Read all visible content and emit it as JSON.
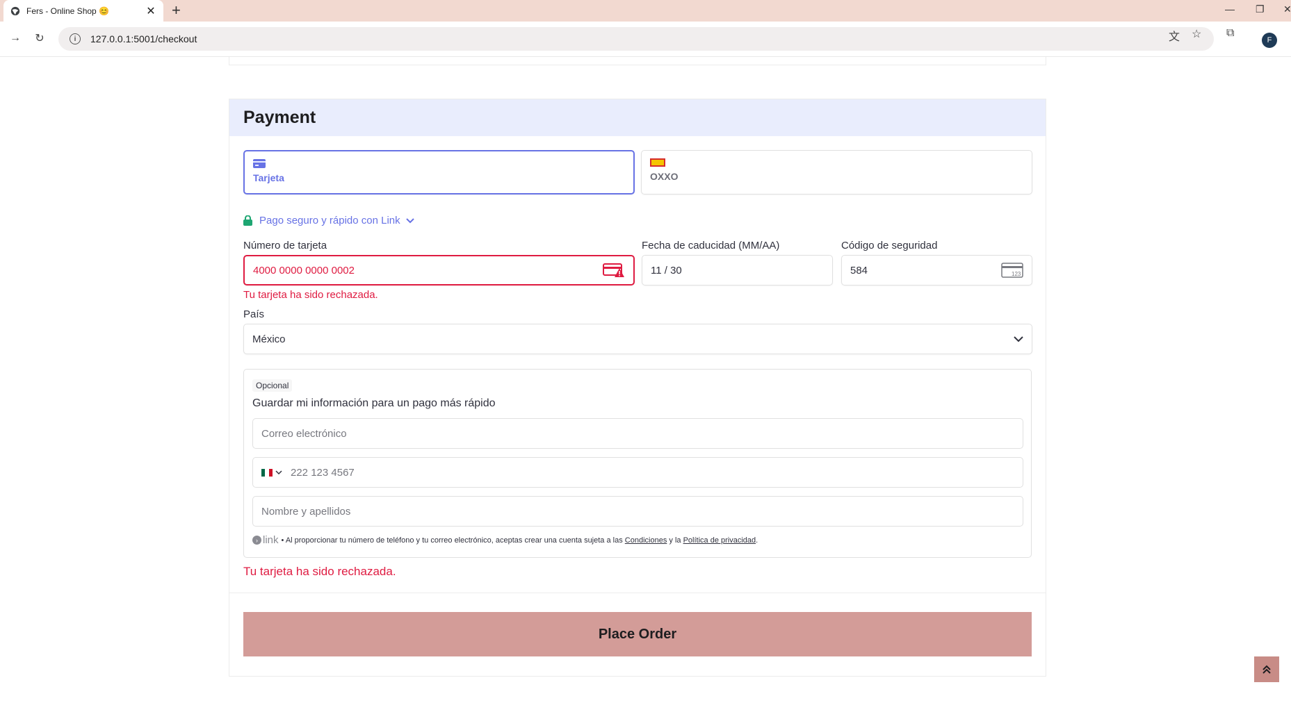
{
  "browser": {
    "tab_title": "Fers - Online Shop 😊",
    "url": "127.0.0.1:5001/checkout"
  },
  "payment": {
    "title": "Payment",
    "methods": [
      {
        "label": "Tarjeta",
        "icon": "credit-card-icon",
        "selected": true
      },
      {
        "label": "OXXO",
        "icon": "oxxo-logo-icon",
        "selected": false
      }
    ],
    "link_text": "Pago seguro y rápido con Link",
    "card_number_label": "Número de tarjeta",
    "card_number_value": "4000 0000 0000 0002",
    "card_error": "Tu tarjeta ha sido rechazada.",
    "expiry_label": "Fecha de caducidad (MM/AA)",
    "expiry_value": "11 / 30",
    "cvc_label": "Código de seguridad",
    "cvc_value": "584",
    "country_label": "País",
    "country_value": "México",
    "save_info": {
      "badge": "Opcional",
      "heading": "Guardar mi información para un pago más rápido",
      "email_placeholder": "Correo electrónico",
      "phone_placeholder": "222 123 4567",
      "name_placeholder": "Nombre y apellidos",
      "legal_logo": "link",
      "legal_prefix": "• Al proporcionar tu número de teléfono y tu correo electrónico, aceptas crear una cuenta sujeta a las",
      "legal_terms": "Condiciones",
      "legal_and": "y la",
      "legal_privacy": "Política de privacidad",
      "legal_end": "."
    },
    "form_error": "Tu tarjeta ha sido rechazada.",
    "submit_label": "Place Order"
  },
  "colors": {
    "accent": "#6772e5",
    "error": "#df1b41",
    "submit": "#d39c98",
    "header_bg": "#e9edfd"
  }
}
